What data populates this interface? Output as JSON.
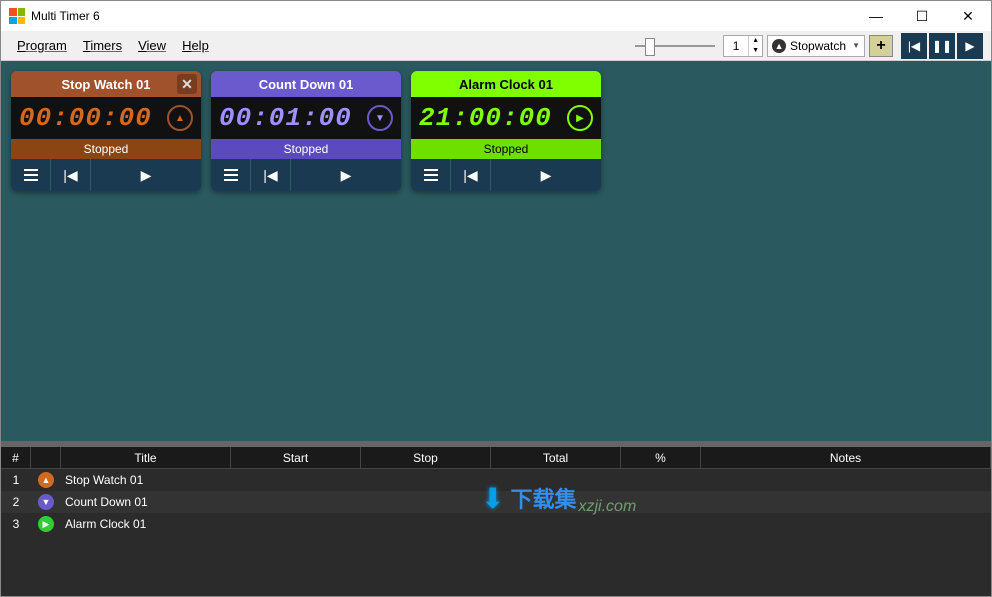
{
  "window": {
    "title": "Multi Timer 6"
  },
  "menu": {
    "program": "Program",
    "timers": "Timers",
    "view": "View",
    "help": "Help"
  },
  "toolbar": {
    "spin_value": "1",
    "combo_label": "Stopwatch"
  },
  "timers": [
    {
      "title": "Stop Watch 01",
      "time": "00:00:00",
      "status": "Stopped",
      "show_close": true,
      "round_glyph": "▲"
    },
    {
      "title": "Count Down 01",
      "time": "00:01:00",
      "status": "Stopped",
      "show_close": false,
      "round_glyph": "▼"
    },
    {
      "title": "Alarm Clock 01",
      "time": "21:00:00",
      "status": "Stopped",
      "show_close": false,
      "round_glyph": "▶"
    }
  ],
  "table": {
    "headers": {
      "num": "#",
      "title": "Title",
      "start": "Start",
      "stop": "Stop",
      "total": "Total",
      "pct": "%",
      "notes": "Notes"
    },
    "rows": [
      {
        "n": "1",
        "title": "Stop Watch 01",
        "icon_glyph": "▲"
      },
      {
        "n": "2",
        "title": "Count Down 01",
        "icon_glyph": "▼"
      },
      {
        "n": "3",
        "title": "Alarm Clock 01",
        "icon_glyph": "▶"
      }
    ]
  },
  "watermark": {
    "cn": "下载集",
    "url": "xzji.com"
  }
}
